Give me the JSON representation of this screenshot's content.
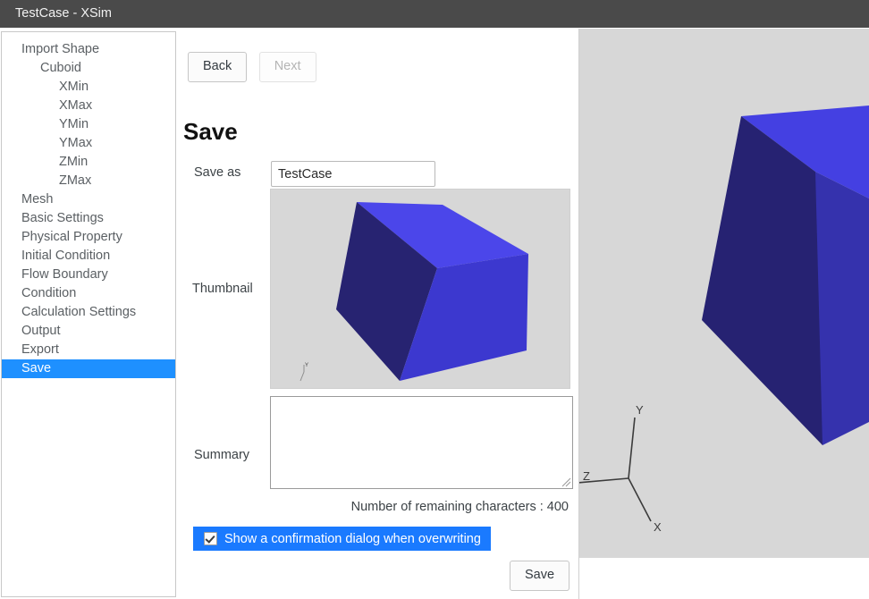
{
  "window": {
    "title": "TestCase - XSim",
    "titlebar_color": "#4a4a4a"
  },
  "sidebar": {
    "items": [
      {
        "label": "Import Shape",
        "level": 0,
        "selected": false
      },
      {
        "label": "Cuboid",
        "level": 1,
        "selected": false
      },
      {
        "label": "XMin",
        "level": 2,
        "selected": false
      },
      {
        "label": "XMax",
        "level": 2,
        "selected": false
      },
      {
        "label": "YMin",
        "level": 2,
        "selected": false
      },
      {
        "label": "YMax",
        "level": 2,
        "selected": false
      },
      {
        "label": "ZMin",
        "level": 2,
        "selected": false
      },
      {
        "label": "ZMax",
        "level": 2,
        "selected": false
      },
      {
        "label": "Mesh",
        "level": 0,
        "selected": false
      },
      {
        "label": "Basic Settings",
        "level": 0,
        "selected": false
      },
      {
        "label": "Physical Property",
        "level": 0,
        "selected": false
      },
      {
        "label": "Initial Condition",
        "level": 0,
        "selected": false
      },
      {
        "label": "Flow Boundary",
        "level": 0,
        "selected": false
      },
      {
        "label": "Condition",
        "level": 0,
        "selected": false
      },
      {
        "label": "Calculation Settings",
        "level": 0,
        "selected": false
      },
      {
        "label": "Output",
        "level": 0,
        "selected": false
      },
      {
        "label": "Export",
        "level": 0,
        "selected": false
      },
      {
        "label": "Save",
        "level": 0,
        "selected": true
      }
    ],
    "selected_color": "#1e90ff"
  },
  "main": {
    "back_label": "Back",
    "next_label": "Next",
    "next_disabled": true,
    "page_title": "Save",
    "save_as_label": "Save as",
    "save_as_value": "TestCase",
    "save_as_placeholder": "",
    "thumbnail_label": "Thumbnail",
    "summary_label": "Summary",
    "summary_value": "",
    "summary_placeholder": "",
    "remaining_characters_text": "Number of remaining characters : 400",
    "remaining_characters": 400,
    "confirm_overwrite_label": "Show a confirmation dialog when overwriting",
    "confirm_overwrite_checked": true,
    "confirm_bar_color": "#1a7aff",
    "save_button_label": "Save"
  },
  "viewport": {
    "background_color": "#d7d7d7",
    "axis_labels": {
      "x": "X",
      "y": "Y",
      "z": "Z"
    },
    "shape_colors": {
      "top_face": "#4440e2",
      "left_face": "#262272",
      "right_face": "#3532ad"
    }
  },
  "thumbnail": {
    "background_color": "#d7d7d7",
    "axis_labels": {
      "y": "Y"
    },
    "shape_colors": {
      "top_face": "#4b46ea",
      "left_face": "#272371",
      "right_face": "#3c38cf"
    }
  }
}
